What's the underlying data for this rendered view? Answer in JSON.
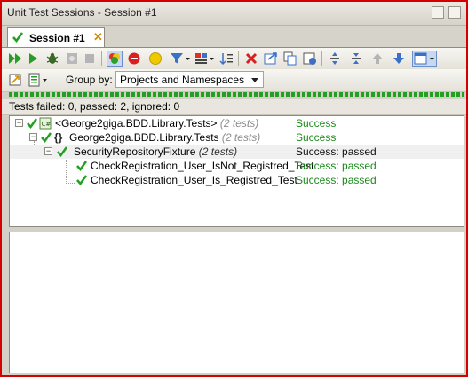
{
  "window": {
    "title": "Unit Test Sessions - Session #1"
  },
  "tab": {
    "label": "Session #1"
  },
  "toolbar": {
    "group_by_label": "Group by:",
    "group_by_value": "Projects and Namespaces"
  },
  "status": {
    "summary": "Tests failed: 0, passed: 2, ignored: 0"
  },
  "tree": {
    "rows": [
      {
        "name": "<George2giga.BDD.Library.Tests>",
        "count": "(2 tests)",
        "status": "Success"
      },
      {
        "name": "George2giga.BDD.Library.Tests",
        "count": "(2 tests)",
        "status": "Success"
      },
      {
        "name": "SecurityRepositoryFixture",
        "count": "(2 tests)",
        "status": "Success: passed"
      },
      {
        "name": "CheckRegistration_User_IsNot_Registred_Test",
        "status": "Success: passed"
      },
      {
        "name": "CheckRegistration_User_Is_Registred_Test",
        "status": "Success: passed"
      }
    ]
  },
  "colors": {
    "success": "#1a8a1a",
    "frame": "#d40000",
    "check": "#22a022"
  }
}
